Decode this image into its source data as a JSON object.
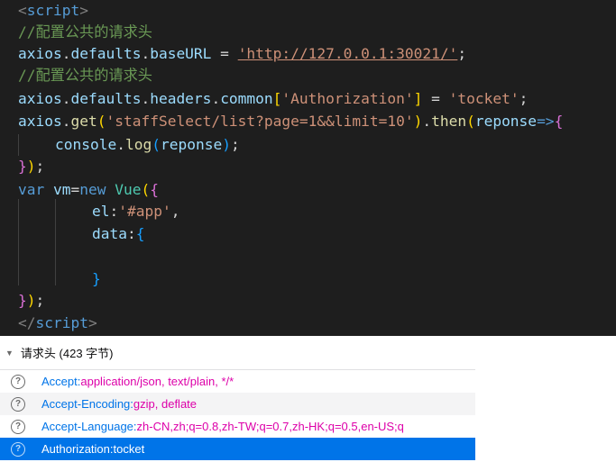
{
  "code": {
    "line1": {
      "open": "<",
      "tag": "script",
      "close": ">"
    },
    "line2": "//配置公共的请求头",
    "line3": {
      "obj": "axios",
      "d1": ".",
      "p1": "defaults",
      "d2": ".",
      "p2": "baseURL",
      "eq": " = ",
      "str": "'http://127.0.0.1:30021/'",
      "end": ";"
    },
    "line4": "//配置公共的请求头",
    "line5": {
      "obj": "axios",
      "d1": ".",
      "p1": "defaults",
      "d2": ".",
      "p2": "headers",
      "d3": ".",
      "p3": "common",
      "lb": "[",
      "key": "'Authorization'",
      "rb": "]",
      "eq": " = ",
      "str": "'tocket'",
      "end": ";"
    },
    "line6": {
      "obj": "axios",
      "d1": ".",
      "fn": "get",
      "lp": "(",
      "str": "'staffSelect/list?page=1&&limit=10'",
      "rp": ")",
      "d2": ".",
      "fn2": "then",
      "lp2": "(",
      "param": "reponse",
      "arrow": "=>",
      "lb": "{"
    },
    "line7": {
      "obj": "console",
      "d1": ".",
      "fn": "log",
      "lp": "(",
      "arg": "reponse",
      "rp": ")",
      "end": ";"
    },
    "line8": {
      "rb": "}",
      "rp": ")",
      "end": ";"
    },
    "line9": {
      "kw": "var",
      "name": "vm",
      "eq": "=",
      "kw2": "new",
      "type": "Vue",
      "lp": "(",
      "lb": "{"
    },
    "line10": {
      "key": "el",
      "colon": ":",
      "str": "'#app'",
      "comma": ","
    },
    "line11": {
      "key": "data",
      "colon": ":",
      "lb": "{"
    },
    "line13": {
      "rb": "}"
    },
    "line14": {
      "rb": "}",
      "rp": ")",
      "end": ";"
    },
    "line15": {
      "open": "</",
      "tag": "script",
      "close": ">"
    }
  },
  "headers_panel": {
    "section_title": "请求头 (423 字节)",
    "help_glyph": "?",
    "rows": [
      {
        "name": "Accept: ",
        "value": "application/json, text/plain, */*"
      },
      {
        "name": "Accept-Encoding: ",
        "value": "gzip, deflate"
      },
      {
        "name": "Accept-Language: ",
        "value": "zh-CN,zh;q=0.8,zh-TW;q=0.7,zh-HK;q=0.5,en-US;q"
      },
      {
        "name": "Authorization: ",
        "value": "tocket"
      }
    ]
  },
  "colors": {
    "editor_bg": "#1e1e1e",
    "selected_row": "#0074e8",
    "header_name": "#0074e8",
    "header_value": "#dd00a9"
  }
}
